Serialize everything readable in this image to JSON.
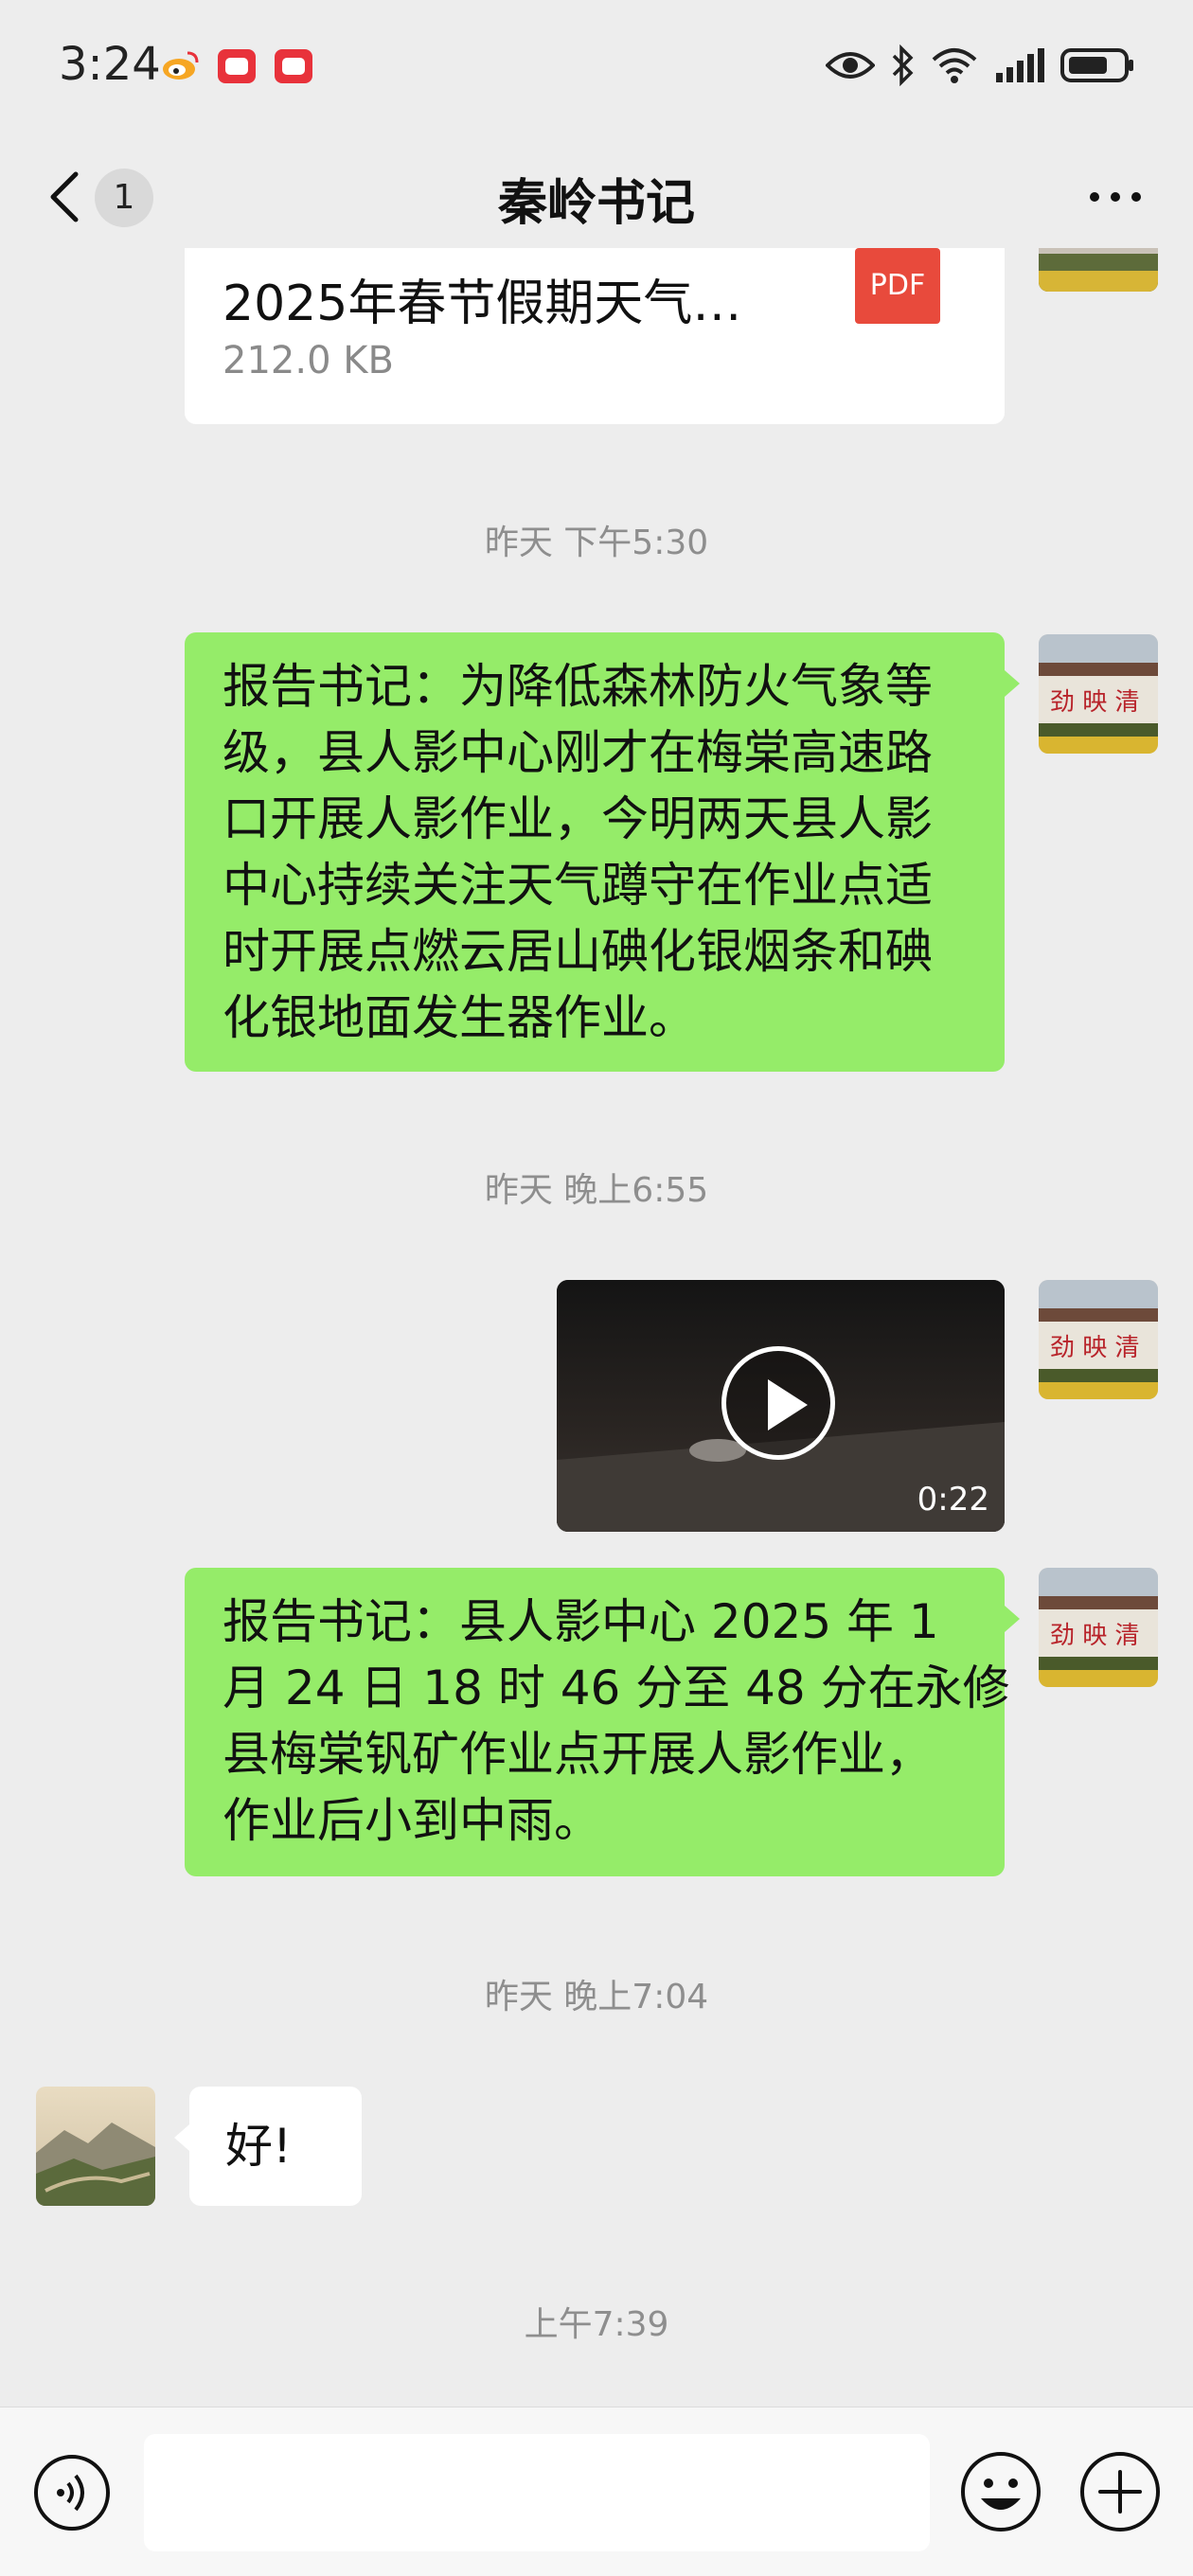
{
  "status_bar": {
    "time": "3:24",
    "icons": [
      "weibo-icon",
      "app-notification-icon",
      "app-notification-icon",
      "eye-icon",
      "bluetooth-icon",
      "wifi-icon",
      "signal-icon",
      "battery-icon"
    ]
  },
  "nav": {
    "back_icon": "chevron-left-icon",
    "unread_count": "1",
    "title": "秦岭书记",
    "more_icon": "more-dots-icon"
  },
  "messages": {
    "file": {
      "name": "2025年春节假期天气…",
      "size": "212.0 KB",
      "type_label": "PDF"
    },
    "ts1": "昨天 下午5:30",
    "msg1": {
      "line1": "报告书记：为降低森林防火气象等",
      "line2": "级，县人影中心刚才在梅棠高速路",
      "line3": "口开展人影作业，今明两天县人影",
      "line4": "中心持续关注天气蹲守在作业点适",
      "line5": "时开展点燃云居山碘化银烟条和碘",
      "line6": "化银地面发生器作业。"
    },
    "ts2": "昨天 晚上6:55",
    "video": {
      "duration": "0:22"
    },
    "msg2": {
      "line1": "报告书记：县人影中心 2025 年 1",
      "line2": "月 24 日 18 时 46 分至 48 分在永修",
      "line3": "县梅棠钒矿作业点开展人影作业，",
      "line4": "作业后小到中雨。"
    },
    "ts3": "昨天 晚上7:04",
    "reply": "好!",
    "ts4": "上午7:39"
  },
  "input_bar": {
    "voice_icon": "voice-icon",
    "emoji_icon": "emoji-icon",
    "plus_icon": "plus-icon",
    "text_value": ""
  },
  "colors": {
    "background": "#ededed",
    "sent_bubble": "#95ec69",
    "received_bubble": "#ffffff",
    "pdf_badge": "#e84a3c"
  }
}
